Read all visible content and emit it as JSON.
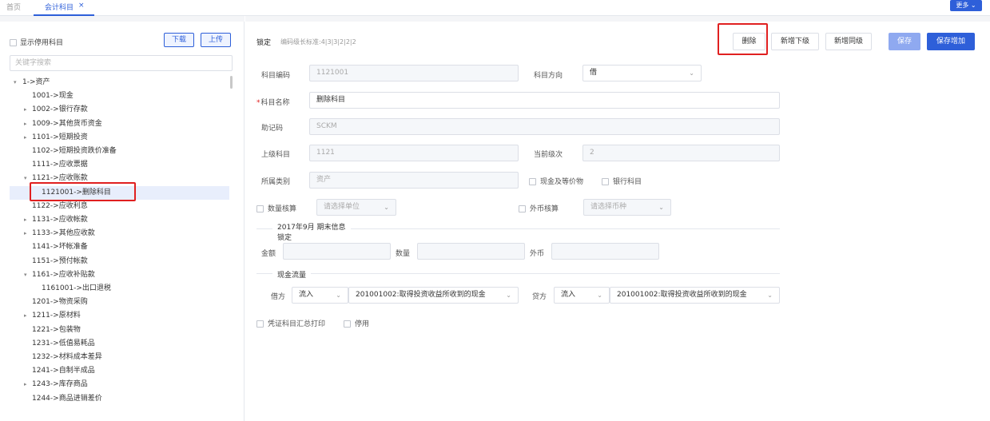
{
  "tabs": {
    "home": "首页",
    "active": "会计科目",
    "close": "×",
    "more": "更多 ⌄"
  },
  "left": {
    "show_disabled": "显示停用科目",
    "download": "下载",
    "upload": "上传",
    "search_placeholder": "关键字搜索",
    "tree": [
      {
        "label": "1->资产",
        "arrow": "▾"
      },
      {
        "label": "1001->现金",
        "arrow": ""
      },
      {
        "label": "1002->银行存款",
        "arrow": "▸"
      },
      {
        "label": "1009->其他货币资金",
        "arrow": "▸"
      },
      {
        "label": "1101->短期投资",
        "arrow": "▸"
      },
      {
        "label": "1102->短期投资跌价准备",
        "arrow": ""
      },
      {
        "label": "1111->应收票据",
        "arrow": ""
      },
      {
        "label": "1121->应收账款",
        "arrow": "▾"
      },
      {
        "label": "1121001->删除科目",
        "arrow": ""
      },
      {
        "label": "1122->应收利息",
        "arrow": ""
      },
      {
        "label": "1131->应收帐款",
        "arrow": "▸"
      },
      {
        "label": "1133->其他应收款",
        "arrow": "▸"
      },
      {
        "label": "1141->坏帐准备",
        "arrow": ""
      },
      {
        "label": "1151->预付帐款",
        "arrow": ""
      },
      {
        "label": "1161->应收补贴款",
        "arrow": "▾"
      },
      {
        "label": "1161001->出口退税",
        "arrow": ""
      },
      {
        "label": "1201->物资采购",
        "arrow": ""
      },
      {
        "label": "1211->原材料",
        "arrow": "▸"
      },
      {
        "label": "1221->包装物",
        "arrow": ""
      },
      {
        "label": "1231->低值易耗品",
        "arrow": ""
      },
      {
        "label": "1232->材料成本差异",
        "arrow": ""
      },
      {
        "label": "1241->自制半成品",
        "arrow": ""
      },
      {
        "label": "1243->库存商品",
        "arrow": "▸"
      },
      {
        "label": "1244->商品进销差价",
        "arrow": ""
      }
    ]
  },
  "right": {
    "lock": "锁定",
    "code_hint": "编码级长标准:4|3|3|2|2|2",
    "buttons": {
      "delete": "删除",
      "add_child": "新增下级",
      "add_sibling": "新增同级",
      "save": "保存",
      "save_add": "保存增加"
    },
    "fields": {
      "code_label": "科目编码",
      "code_value": "1121001",
      "direction_label": "科目方向",
      "direction_value": "借",
      "name_label": "科目名称",
      "name_value": "删除科目",
      "mnemonic_label": "助记码",
      "mnemonic_value": "SCKM",
      "parent_label": "上级科目",
      "parent_value": "1121",
      "level_label": "当前级次",
      "level_value": "2",
      "category_label": "所属类别",
      "category_value": "资产",
      "cash_equiv": "现金及等价物",
      "bank_account": "银行科目",
      "qty_check": "数量核算",
      "unit_placeholder": "请选择单位",
      "fx_check": "外币核算",
      "currency_placeholder": "请选择币种",
      "period_title": "2017年9月 期末信息",
      "period_lock": "锁定",
      "amount_label": "金额",
      "qty_label": "数量",
      "fx_label": "外币",
      "cashflow_title": "现金流量",
      "debit_label": "借方",
      "debit_flow": "流入",
      "debit_item": "201001002:取得投资收益所收到的现金",
      "credit_label": "贷方",
      "credit_flow": "流入",
      "credit_item": "201001002:取得投资收益所收到的现金",
      "voucher_print": "凭证科目汇总打印",
      "disable": "停用"
    }
  }
}
